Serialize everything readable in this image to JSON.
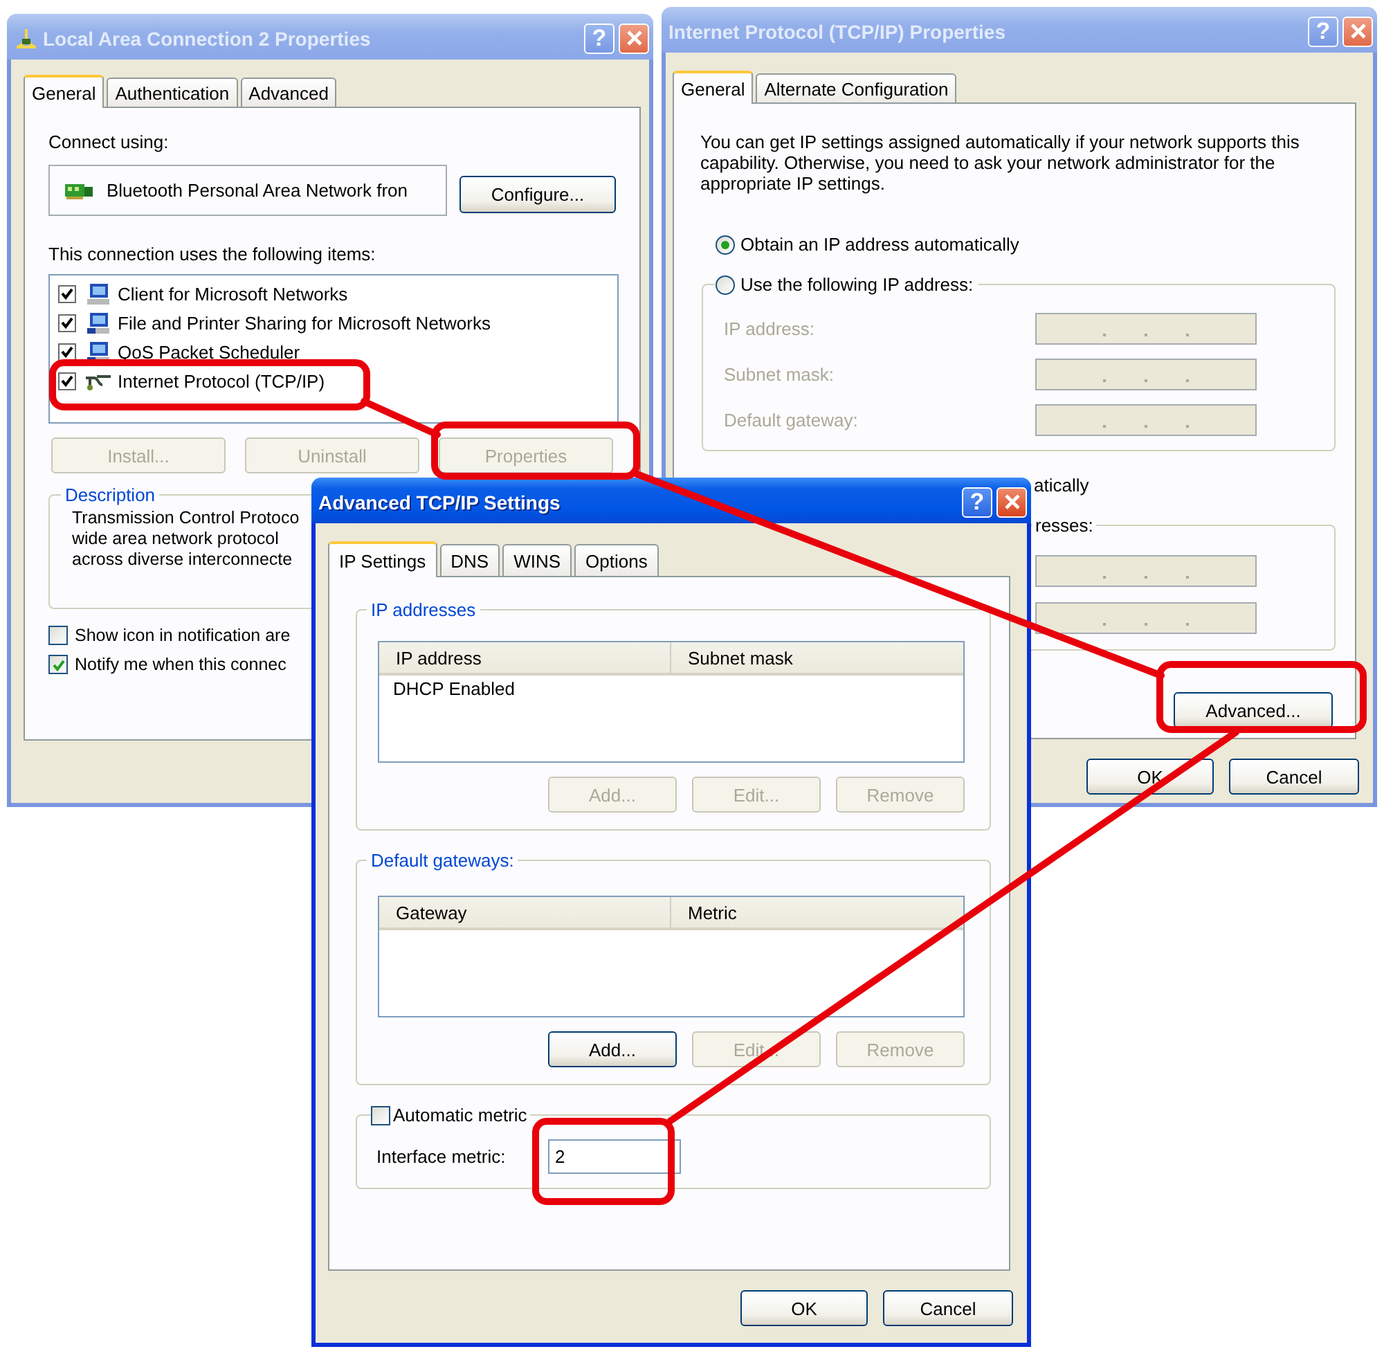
{
  "connection_window": {
    "title": "Local Area Connection 2 Properties",
    "active": false,
    "help_button": "?",
    "tabs": [
      {
        "label": "General",
        "selected": true
      },
      {
        "label": "Authentication",
        "selected": false
      },
      {
        "label": "Advanced",
        "selected": false
      }
    ],
    "connect_using_label": "Connect using:",
    "adapter": "Bluetooth Personal Area Network fron",
    "configure_button": "Configure...",
    "items_label": "This connection uses the following items:",
    "items": [
      {
        "kind": "client",
        "label": "Client for Microsoft Networks",
        "checked": true
      },
      {
        "kind": "service",
        "label": "File and Printer Sharing for Microsoft Networks",
        "checked": true
      },
      {
        "kind": "service",
        "label": "QoS Packet Scheduler",
        "checked": true
      },
      {
        "kind": "protocol",
        "label": "Internet Protocol (TCP/IP)",
        "checked": true
      }
    ],
    "buttons": [
      {
        "label": "Install...",
        "disabled": true
      },
      {
        "label": "Uninstall",
        "disabled": true
      },
      {
        "label": "Properties",
        "disabled": true
      }
    ],
    "description": {
      "legend": "Description",
      "lines": [
        "Transmission Control Protoco",
        "wide area network protocol",
        "across diverse interconnecte"
      ]
    },
    "options": [
      {
        "label": "Show icon in notification are",
        "checked": false
      },
      {
        "label": "Notify me when this connec",
        "checked": true
      }
    ]
  },
  "tcpip_window": {
    "title": "Internet Protocol (TCP/IP) Properties",
    "active": false,
    "help_button": "?",
    "tabs": [
      {
        "label": "General",
        "selected": true
      },
      {
        "label": "Alternate Configuration",
        "selected": false
      }
    ],
    "intro": "You can get IP settings assigned automatically if your network supports this capability. Otherwise, you need to ask your network administrator for the appropriate IP settings.",
    "ip_mode": [
      {
        "label": "Obtain an IP address automatically",
        "selected": true
      },
      {
        "label": "Use the following IP address:",
        "selected": false
      }
    ],
    "ip_fields": [
      {
        "label": "IP address:",
        "disabled": true
      },
      {
        "label": "Subnet mask:",
        "disabled": true
      },
      {
        "label": "Default gateway:",
        "disabled": true
      }
    ],
    "dns_mode_fragment": "atically",
    "dns_group_fragment": "resses:",
    "dns_fields": [
      {
        "disabled": true
      },
      {
        "disabled": true
      }
    ],
    "advanced_button": "Advanced...",
    "buttons": [
      "OK",
      "Cancel"
    ]
  },
  "advanced_window": {
    "title": "Advanced TCP/IP Settings",
    "active": true,
    "help_button": "?",
    "tabs": [
      {
        "label": "IP Settings",
        "selected": true
      },
      {
        "label": "DNS",
        "selected": false
      },
      {
        "label": "WINS",
        "selected": false
      },
      {
        "label": "Options",
        "selected": false
      }
    ],
    "ip_group": {
      "legend": "IP addresses",
      "columns": [
        "IP address",
        "Subnet mask"
      ],
      "rows": [
        [
          "DHCP Enabled"
        ]
      ],
      "buttons": [
        {
          "label": "Add...",
          "disabled": true
        },
        {
          "label": "Edit...",
          "disabled": true
        },
        {
          "label": "Remove",
          "disabled": true
        }
      ]
    },
    "gateway_group": {
      "legend": "Default gateways:",
      "columns": [
        "Gateway",
        "Metric"
      ],
      "buttons": [
        {
          "label": "Add...",
          "disabled": false
        },
        {
          "label": "Edit...",
          "disabled": true
        },
        {
          "label": "Remove",
          "disabled": true
        }
      ]
    },
    "metric_group": {
      "auto_metric": {
        "label": "Automatic metric",
        "checked": false
      },
      "interface_label": "Interface metric:",
      "interface_value": "2"
    },
    "buttons": [
      "OK",
      "Cancel"
    ]
  }
}
